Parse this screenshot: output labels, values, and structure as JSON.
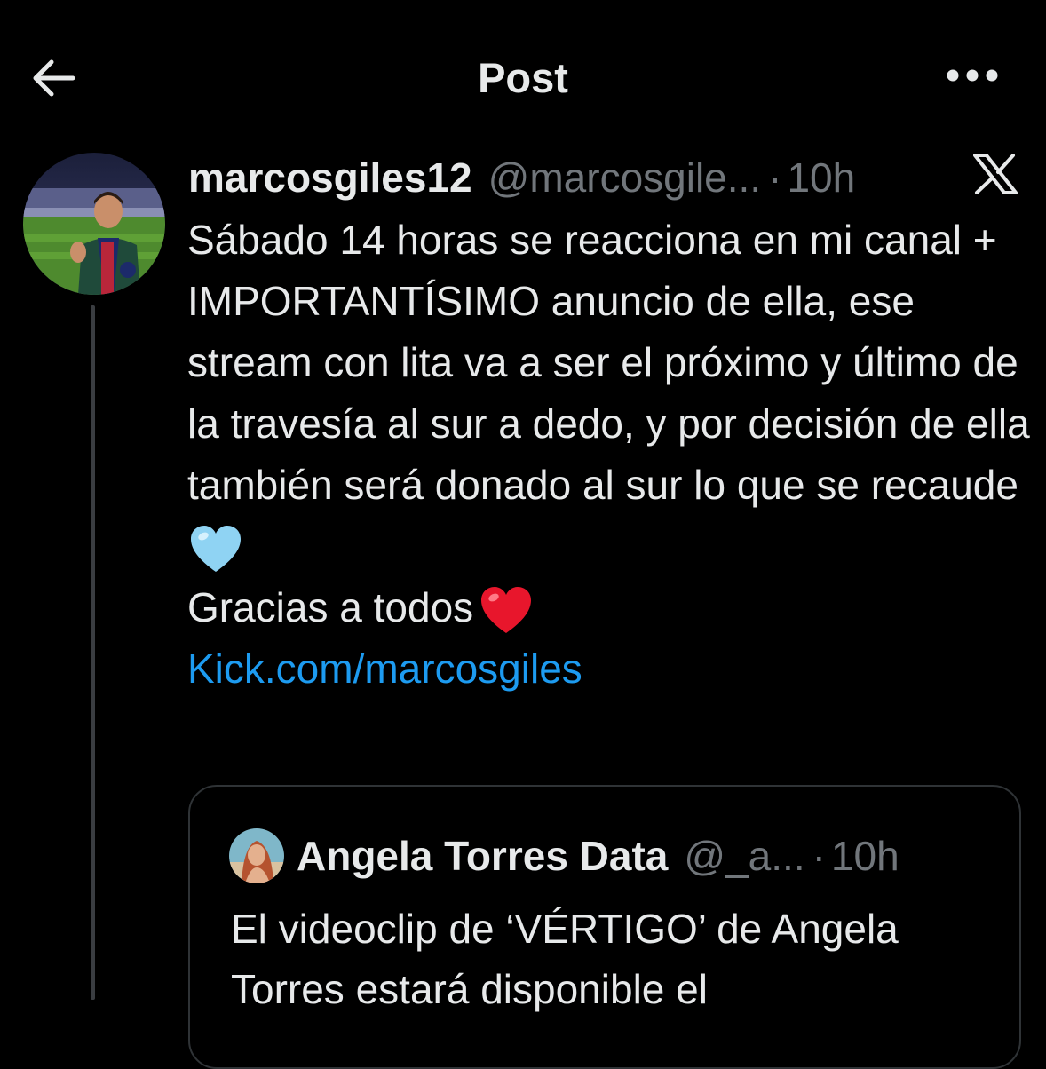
{
  "header": {
    "title": "Post",
    "back_icon": "arrow-left-icon",
    "more_icon": "more-horizontal-icon"
  },
  "post": {
    "author_name": "marcosgiles12",
    "author_handle": "@marcosgile...",
    "separator": "·",
    "time": "10h",
    "platform_icon": "x-logo-icon",
    "body_lines": [
      "Sábado 14 horas se reacciona en mi canal + IMPORTANTÍSIMO anuncio de ella, ese stream con lita va a ser el próximo y último de la travesía al sur a dedo, y por decisión de ella también será donado al sur lo que se recaude"
    ],
    "blue_heart_icon": "light-blue-heart-emoji",
    "thanks_text": "Gracias a todos",
    "red_heart_icon": "red-heart-emoji",
    "link_text": "Kick.com/marcosgiles"
  },
  "quote": {
    "author_name": "Angela Torres Data",
    "author_handle": "@_a...",
    "separator": "·",
    "time": "10h",
    "text": "El videoclip de ‘VÉRTIGO’ de Angela Torres estará disponible el"
  },
  "colors": {
    "background": "#000000",
    "text_primary": "#e7e9ea",
    "text_secondary": "#71767b",
    "link": "#1d9bf0",
    "border": "#2f3336"
  }
}
